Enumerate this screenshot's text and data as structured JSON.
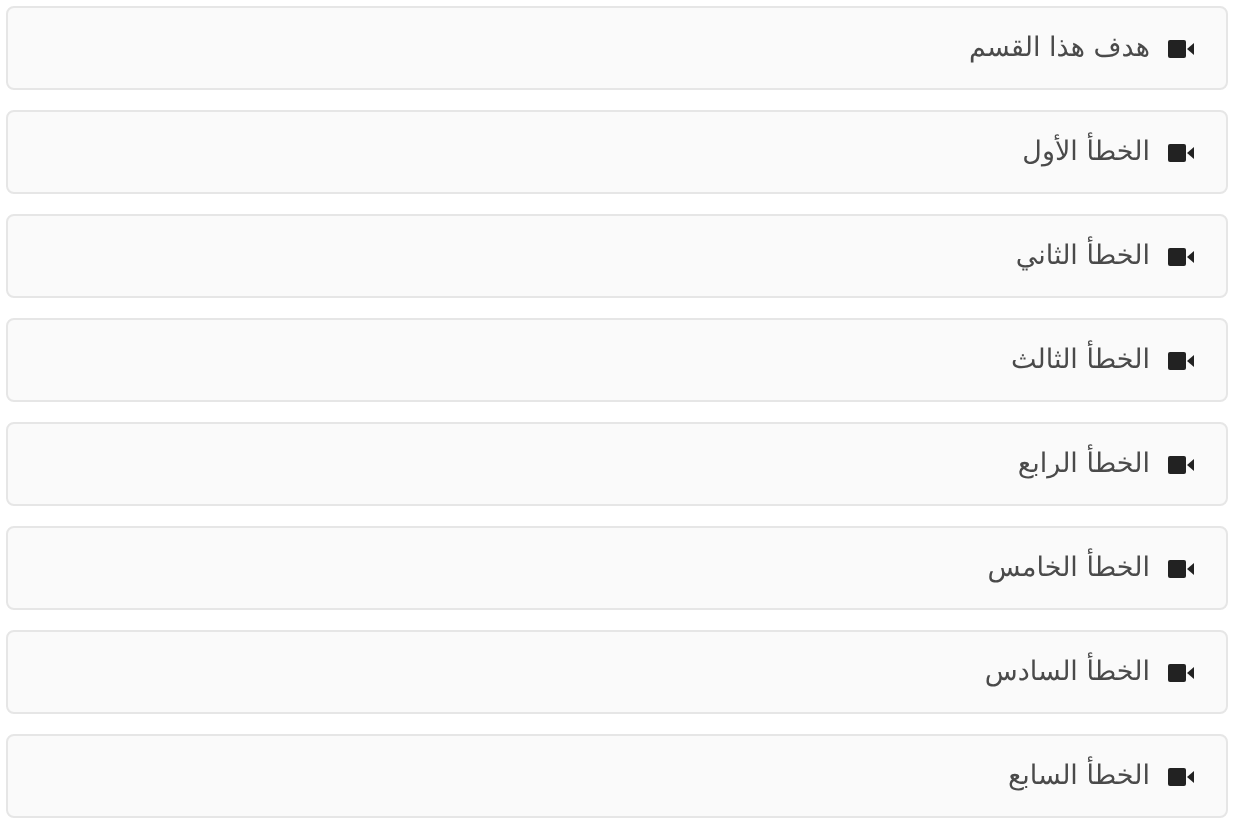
{
  "sections": [
    {
      "title": "هدف هذا القسم"
    },
    {
      "title": "الخطأ الأول"
    },
    {
      "title": "الخطأ الثاني"
    },
    {
      "title": "الخطأ الثالث"
    },
    {
      "title": "الخطأ الرابع"
    },
    {
      "title": "الخطأ الخامس"
    },
    {
      "title": "الخطأ السادس"
    },
    {
      "title": "الخطأ السابع"
    }
  ]
}
